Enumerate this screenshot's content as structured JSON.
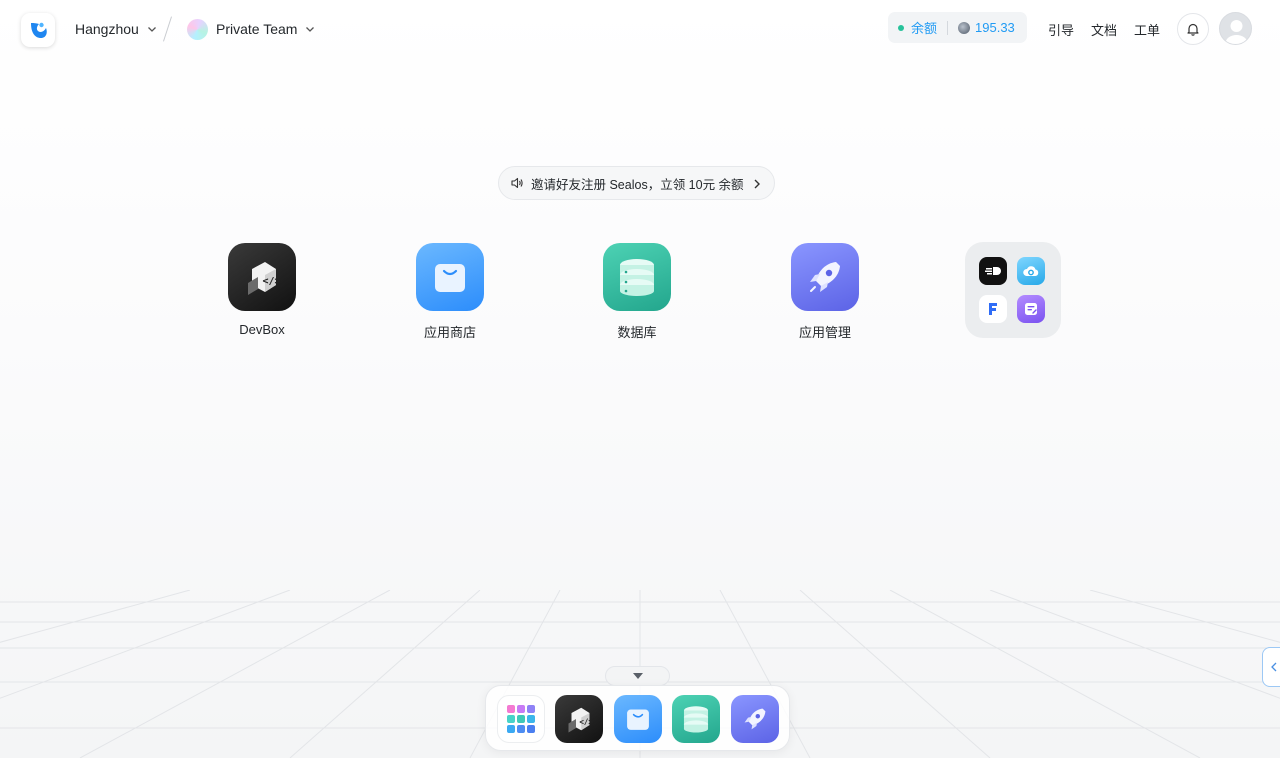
{
  "header": {
    "region": "Hangzhou",
    "team": "Private Team",
    "balance_label": "余额",
    "balance_value": "195.33",
    "nav": {
      "guide": "引导",
      "docs": "文档",
      "tickets": "工单"
    }
  },
  "banner": {
    "text": "邀请好友注册 Sealos，立领 10元 余额"
  },
  "apps": [
    {
      "label": "DevBox",
      "icon": "devbox-icon"
    },
    {
      "label": "应用商店",
      "icon": "app-store-icon"
    },
    {
      "label": "数据库",
      "icon": "database-icon"
    },
    {
      "label": "应用管理",
      "icon": "app-launchpad-icon"
    }
  ],
  "folder": {
    "icons": [
      "terminal-speed-icon",
      "cloud-icon",
      "f-app-icon",
      "notes-icon"
    ]
  },
  "dock": {
    "icons": [
      "app-grid-icon",
      "devbox-icon",
      "app-store-icon",
      "database-icon",
      "app-launchpad-icon"
    ]
  },
  "colors": {
    "accent_blue": "#219BF4",
    "status_green": "#27C29A",
    "devbox_dark": "#1E1E1E",
    "store_blue": "#3D9BFD",
    "db_green": "#31B99C",
    "launchpad_purple": "#6F78F4"
  }
}
